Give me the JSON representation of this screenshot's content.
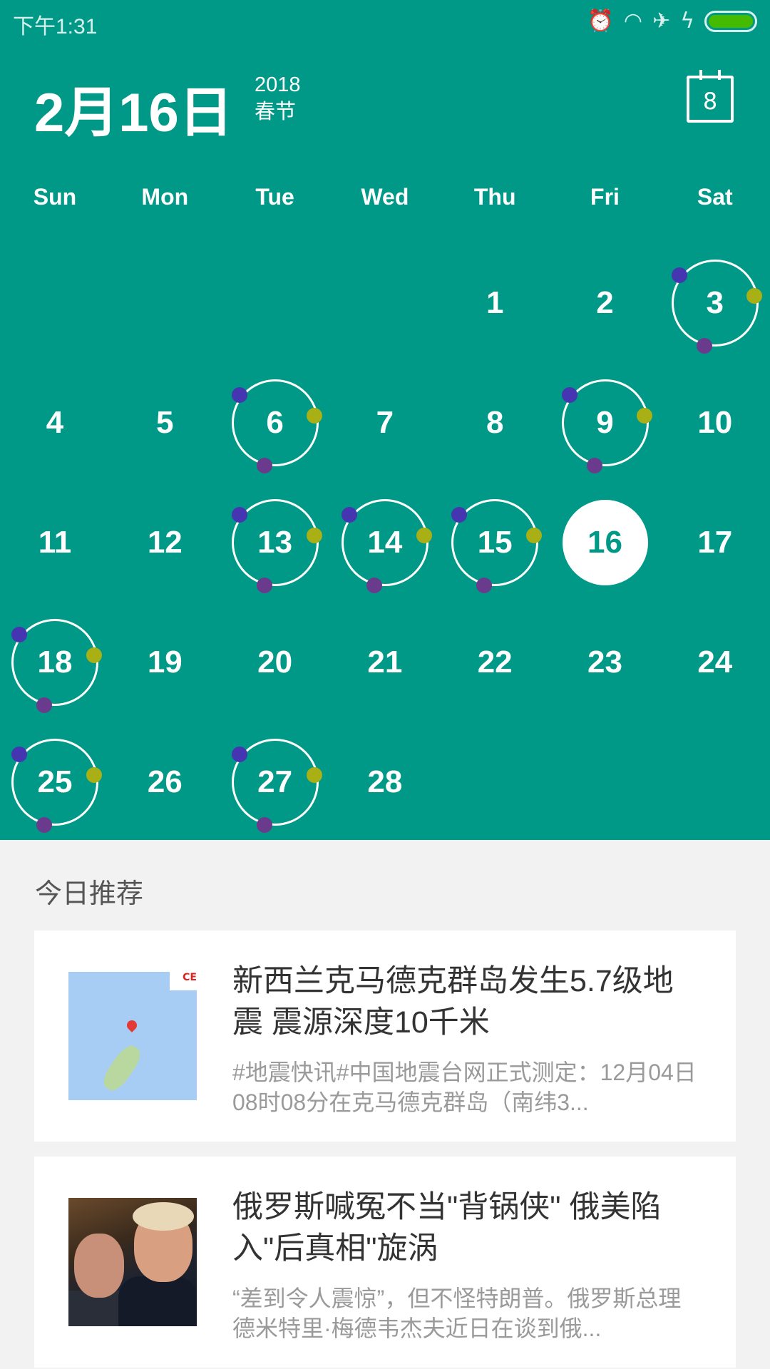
{
  "status_bar": {
    "time": "下午1:31",
    "icons": [
      "alarm-icon",
      "wifi-icon",
      "airplane-mode-icon",
      "charging-icon",
      "battery-icon"
    ],
    "battery_color": "#44bb00"
  },
  "header": {
    "date": "2月16日",
    "year": "2018",
    "festival": "春节",
    "today_button": "8"
  },
  "colors": {
    "primary": "#009987",
    "dot_blue": "#4535b0",
    "dot_olive": "#a9b015",
    "dot_purple": "#6a3a8c"
  },
  "calendar": {
    "weekdays": [
      "Sun",
      "Mon",
      "Tue",
      "Wed",
      "Thu",
      "Fri",
      "Sat"
    ],
    "first_weekday": 4,
    "days_in_month": 28,
    "selected_day": 16,
    "event_days": [
      3,
      6,
      9,
      13,
      14,
      15,
      18,
      25,
      27
    ],
    "days": [
      "1",
      "2",
      "3",
      "4",
      "5",
      "6",
      "7",
      "8",
      "9",
      "10",
      "11",
      "12",
      "13",
      "14",
      "15",
      "16",
      "17",
      "18",
      "19",
      "20",
      "21",
      "22",
      "23",
      "24",
      "25",
      "26",
      "27",
      "28"
    ]
  },
  "recommend": {
    "heading": "今日推荐",
    "items": [
      {
        "title": "新西兰克马德克群岛发生5.7级地震 震源深度10千米",
        "snippet": "#地震快讯#中国地震台网正式测定：12月04日08时08分在克马德克群岛（南纬3...",
        "image": "earthquake-map",
        "image_text": "CE"
      },
      {
        "title": "俄罗斯喊冤不当\"背锅侠\" 俄美陷入\"后真相\"旋涡",
        "snippet": "“差到令人震惊”，但不怪特朗普。俄罗斯总理德米特里·梅德韦杰夫近日在谈到俄...",
        "image": "news-photo"
      }
    ]
  }
}
